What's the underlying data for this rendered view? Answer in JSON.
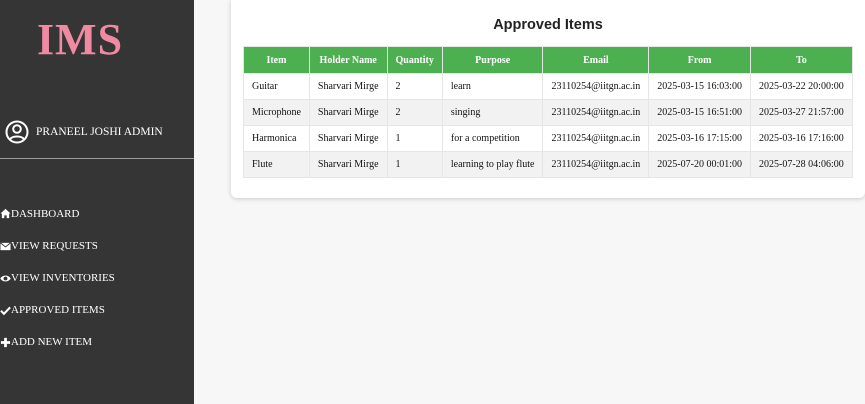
{
  "sidebar": {
    "logo": "IMS",
    "user_name": "PRANEEL JOSHI ADMIN",
    "nav": [
      {
        "label": "DASHBOARD",
        "icon": "home-icon"
      },
      {
        "label": "VIEW REQUESTS",
        "icon": "envelope-icon"
      },
      {
        "label": "VIEW INVENTORIES",
        "icon": "eye-icon"
      },
      {
        "label": "APPROVED ITEMS",
        "icon": "check-icon"
      },
      {
        "label": "ADD NEW ITEM",
        "icon": "plus-icon"
      }
    ]
  },
  "main": {
    "title": "Approved Items",
    "table": {
      "headers": [
        "Item",
        "Holder Name",
        "Quantity",
        "Purpose",
        "Email",
        "From",
        "To"
      ],
      "rows": [
        [
          "Guitar",
          "Sharvari Mirge",
          "2",
          "learn",
          "23110254@iitgn.ac.in",
          "2025-03-15 16:03:00",
          "2025-03-22 20:00:00"
        ],
        [
          "Microphone",
          "Sharvari Mirge",
          "2",
          "singing",
          "23110254@iitgn.ac.in",
          "2025-03-15 16:51:00",
          "2025-03-27 21:57:00"
        ],
        [
          "Harmonica",
          "Sharvari Mirge",
          "1",
          "for a competition",
          "23110254@iitgn.ac.in",
          "2025-03-16 17:15:00",
          "2025-03-16 17:16:00"
        ],
        [
          "Flute",
          "Sharvari Mirge",
          "1",
          "learning to play flute",
          "23110254@iitgn.ac.in",
          "2025-07-20 00:01:00",
          "2025-07-28 04:06:00"
        ]
      ]
    }
  },
  "colors": {
    "sidebar_bg": "#353535",
    "logo": "#f08aa3",
    "table_header": "#4caf50"
  }
}
